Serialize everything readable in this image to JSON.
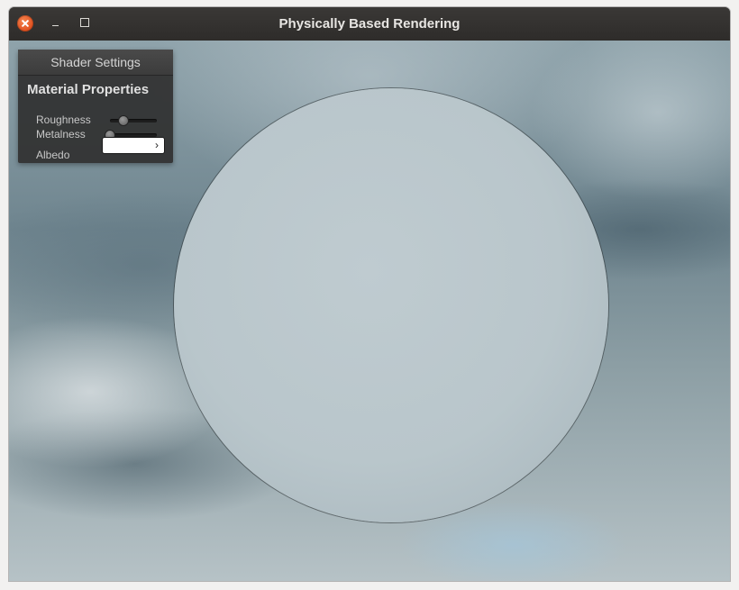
{
  "window": {
    "title": "Physically Based Rendering"
  },
  "titlebar": {
    "buttons": [
      "close-icon",
      "minimize-icon",
      "maximize-icon"
    ]
  },
  "panel": {
    "header": "Shader Settings",
    "section_title": "Material Properties",
    "roughness": {
      "label": "Roughness",
      "value": 0.28
    },
    "metalness": {
      "label": "Metalness",
      "value": 0.0
    },
    "albedo": {
      "label": "Albedo",
      "color": "#ffffff",
      "chevron": "›"
    }
  },
  "colors": {
    "accent_close": "#e95420",
    "panel_bg": "#303030",
    "sphere_base": "#bac7cc"
  }
}
